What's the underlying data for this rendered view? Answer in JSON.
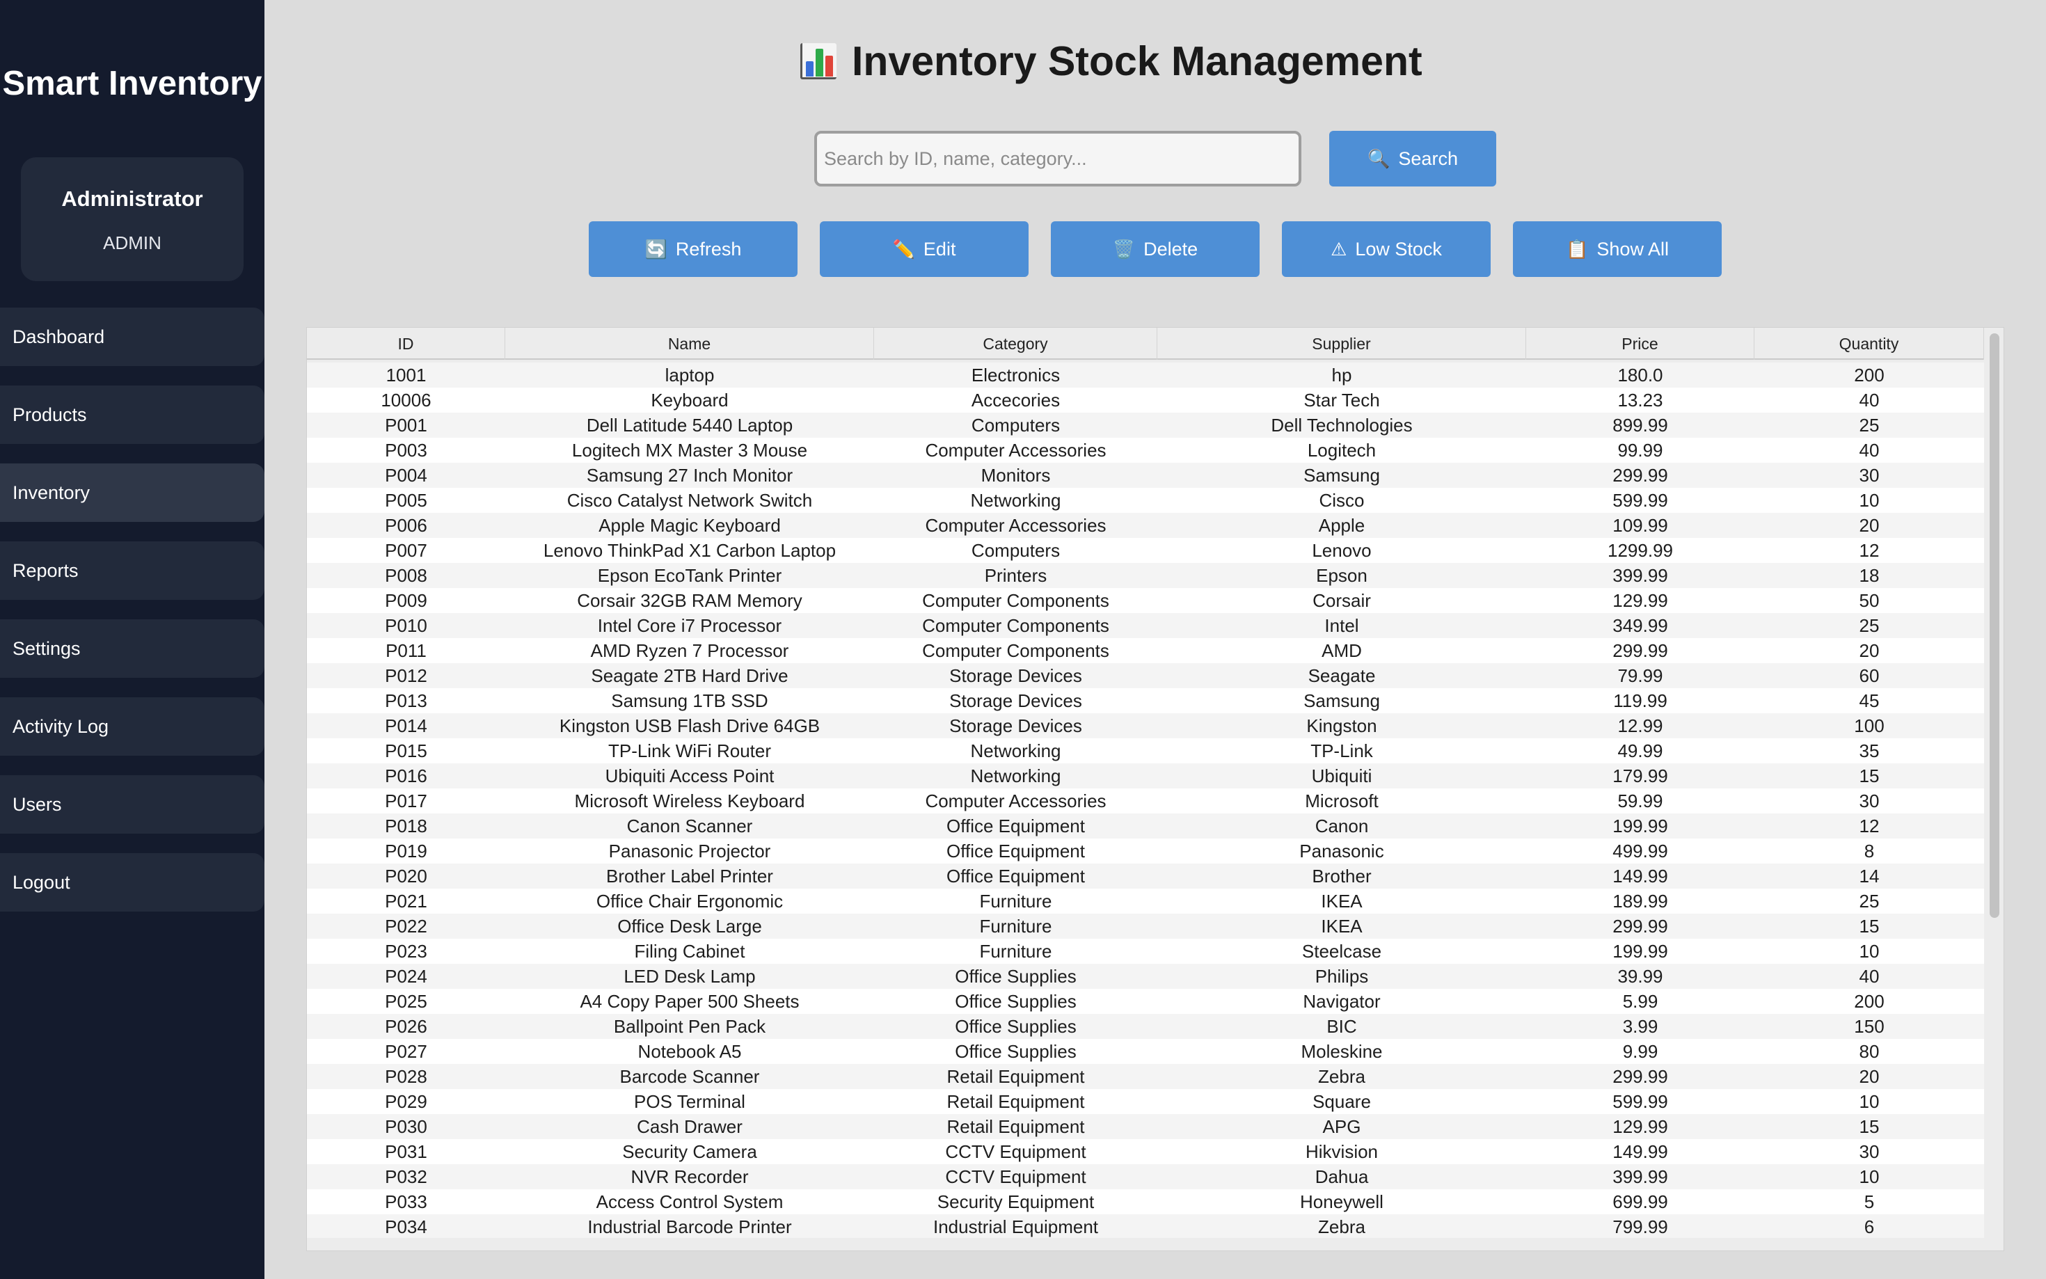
{
  "sidebar": {
    "app_title": "Smart Inventory",
    "user": {
      "name": "Administrator",
      "role": "ADMIN"
    },
    "items": [
      {
        "label": "Dashboard"
      },
      {
        "label": "Products"
      },
      {
        "label": "Inventory",
        "active": true
      },
      {
        "label": "Reports"
      },
      {
        "label": "Settings"
      },
      {
        "label": "Activity Log"
      },
      {
        "label": "Users"
      },
      {
        "label": "Logout"
      }
    ]
  },
  "header": {
    "title": "Inventory Stock Management",
    "title_icon": "bar-chart-icon"
  },
  "search": {
    "placeholder": "Search by ID, name, category...",
    "value": "",
    "button_label": "Search",
    "button_icon": "magnifier-icon"
  },
  "toolbar": {
    "refresh_label": "Refresh",
    "refresh_icon": "refresh-icon",
    "edit_label": "Edit",
    "edit_icon": "pencil-icon",
    "delete_label": "Delete",
    "delete_icon": "trash-icon",
    "low_stock_label": "Low Stock",
    "low_stock_icon": "warning-icon",
    "show_all_label": "Show All",
    "show_all_icon": "clipboard-icon"
  },
  "colors": {
    "sidebar_bg": "#141b2d",
    "nav_item_bg": "#222a3b",
    "accent": "#4e8fd6",
    "page_bg": "#dcdcdc"
  },
  "table": {
    "columns": [
      "ID",
      "Name",
      "Category",
      "Supplier",
      "Price",
      "Quantity"
    ],
    "rows": [
      [
        "1001",
        "laptop",
        "Electronics",
        "hp",
        "180.0",
        "200"
      ],
      [
        "10006",
        "Keyboard",
        "Accecories",
        "Star Tech",
        "13.23",
        "40"
      ],
      [
        "P001",
        "Dell Latitude 5440 Laptop",
        "Computers",
        "Dell Technologies",
        "899.99",
        "25"
      ],
      [
        "P003",
        "Logitech MX Master 3 Mouse",
        "Computer Accessories",
        "Logitech",
        "99.99",
        "40"
      ],
      [
        "P004",
        "Samsung 27 Inch Monitor",
        "Monitors",
        "Samsung",
        "299.99",
        "30"
      ],
      [
        "P005",
        "Cisco Catalyst Network Switch",
        "Networking",
        "Cisco",
        "599.99",
        "10"
      ],
      [
        "P006",
        "Apple Magic Keyboard",
        "Computer Accessories",
        "Apple",
        "109.99",
        "20"
      ],
      [
        "P007",
        "Lenovo ThinkPad X1 Carbon Laptop",
        "Computers",
        "Lenovo",
        "1299.99",
        "12"
      ],
      [
        "P008",
        "Epson EcoTank Printer",
        "Printers",
        "Epson",
        "399.99",
        "18"
      ],
      [
        "P009",
        "Corsair 32GB RAM Memory",
        "Computer Components",
        "Corsair",
        "129.99",
        "50"
      ],
      [
        "P010",
        "Intel Core i7 Processor",
        "Computer Components",
        "Intel",
        "349.99",
        "25"
      ],
      [
        "P011",
        "AMD Ryzen 7 Processor",
        "Computer Components",
        "AMD",
        "299.99",
        "20"
      ],
      [
        "P012",
        "Seagate 2TB Hard Drive",
        "Storage Devices",
        "Seagate",
        "79.99",
        "60"
      ],
      [
        "P013",
        "Samsung 1TB SSD",
        "Storage Devices",
        "Samsung",
        "119.99",
        "45"
      ],
      [
        "P014",
        "Kingston USB Flash Drive 64GB",
        "Storage Devices",
        "Kingston",
        "12.99",
        "100"
      ],
      [
        "P015",
        "TP-Link WiFi Router",
        "Networking",
        "TP-Link",
        "49.99",
        "35"
      ],
      [
        "P016",
        "Ubiquiti Access Point",
        "Networking",
        "Ubiquiti",
        "179.99",
        "15"
      ],
      [
        "P017",
        "Microsoft Wireless Keyboard",
        "Computer Accessories",
        "Microsoft",
        "59.99",
        "30"
      ],
      [
        "P018",
        "Canon Scanner",
        "Office Equipment",
        "Canon",
        "199.99",
        "12"
      ],
      [
        "P019",
        "Panasonic Projector",
        "Office Equipment",
        "Panasonic",
        "499.99",
        "8"
      ],
      [
        "P020",
        "Brother Label Printer",
        "Office Equipment",
        "Brother",
        "149.99",
        "14"
      ],
      [
        "P021",
        "Office Chair Ergonomic",
        "Furniture",
        "IKEA",
        "189.99",
        "25"
      ],
      [
        "P022",
        "Office Desk Large",
        "Furniture",
        "IKEA",
        "299.99",
        "15"
      ],
      [
        "P023",
        "Filing Cabinet",
        "Furniture",
        "Steelcase",
        "199.99",
        "10"
      ],
      [
        "P024",
        "LED Desk Lamp",
        "Office Supplies",
        "Philips",
        "39.99",
        "40"
      ],
      [
        "P025",
        "A4 Copy Paper 500 Sheets",
        "Office Supplies",
        "Navigator",
        "5.99",
        "200"
      ],
      [
        "P026",
        "Ballpoint Pen Pack",
        "Office Supplies",
        "BIC",
        "3.99",
        "150"
      ],
      [
        "P027",
        "Notebook A5",
        "Office Supplies",
        "Moleskine",
        "9.99",
        "80"
      ],
      [
        "P028",
        "Barcode Scanner",
        "Retail Equipment",
        "Zebra",
        "299.99",
        "20"
      ],
      [
        "P029",
        "POS Terminal",
        "Retail Equipment",
        "Square",
        "599.99",
        "10"
      ],
      [
        "P030",
        "Cash Drawer",
        "Retail Equipment",
        "APG",
        "129.99",
        "15"
      ],
      [
        "P031",
        "Security Camera",
        "CCTV Equipment",
        "Hikvision",
        "149.99",
        "30"
      ],
      [
        "P032",
        "NVR Recorder",
        "CCTV Equipment",
        "Dahua",
        "399.99",
        "10"
      ],
      [
        "P033",
        "Access Control System",
        "Security Equipment",
        "Honeywell",
        "699.99",
        "5"
      ],
      [
        "P034",
        "Industrial Barcode Printer",
        "Industrial Equipment",
        "Zebra",
        "799.99",
        "6"
      ]
    ]
  }
}
